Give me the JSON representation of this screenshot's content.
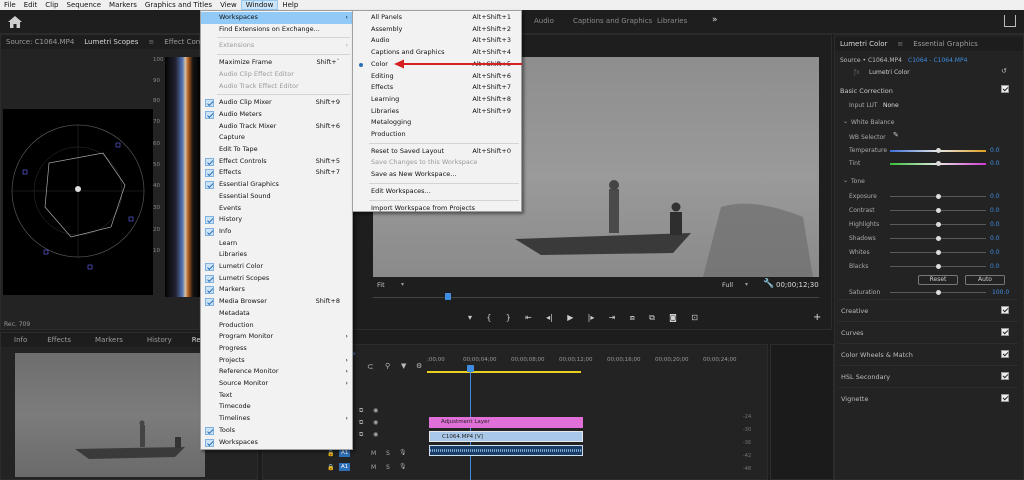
{
  "menubar": {
    "items": [
      "File",
      "Edit",
      "Clip",
      "Sequence",
      "Markers",
      "Graphics and Titles",
      "View",
      "Window",
      "Help"
    ],
    "active": "Window"
  },
  "header": {
    "tabs": [
      "Audio",
      "Captions and Graphics",
      "Libraries"
    ],
    "more": "»"
  },
  "source_panel": {
    "source_label": "Source: C1064.MP4",
    "tab_scopes": "Lumetri Scopes",
    "tab_effects": "Effect Controls",
    "scale": [
      "100",
      "90",
      "80",
      "70",
      "60",
      "50",
      "40",
      "30",
      "20",
      "10"
    ],
    "footer": "Rec. 709"
  },
  "bottom_left": {
    "tabs": [
      "Info",
      "Effects",
      "Markers",
      "History",
      "Reference"
    ]
  },
  "window_menu": {
    "items": [
      {
        "label": "Workspaces",
        "shortcut": "",
        "check": false,
        "submenu": true,
        "disabled": false,
        "highlight": true
      },
      {
        "label": "Find Extensions on Exchange...",
        "shortcut": "",
        "check": false,
        "submenu": false,
        "disabled": false
      },
      {
        "sep": true
      },
      {
        "label": "Extensions",
        "shortcut": "",
        "check": false,
        "submenu": true,
        "disabled": true
      },
      {
        "sep": true
      },
      {
        "label": "Maximize Frame",
        "shortcut": "Shift+`",
        "check": false,
        "submenu": false,
        "disabled": false
      },
      {
        "label": "Audio Clip Effect Editor",
        "shortcut": "",
        "check": false,
        "submenu": false,
        "disabled": true
      },
      {
        "label": "Audio Track Effect Editor",
        "shortcut": "",
        "check": false,
        "submenu": false,
        "disabled": true
      },
      {
        "sep": true
      },
      {
        "label": "Audio Clip Mixer",
        "shortcut": "Shift+9",
        "check": true,
        "submenu": false,
        "disabled": false
      },
      {
        "label": "Audio Meters",
        "shortcut": "",
        "check": true,
        "submenu": false,
        "disabled": false
      },
      {
        "label": "Audio Track Mixer",
        "shortcut": "Shift+6",
        "check": false,
        "submenu": false,
        "disabled": false
      },
      {
        "label": "Capture",
        "shortcut": "",
        "check": false,
        "submenu": false,
        "disabled": false
      },
      {
        "label": "Edit To Tape",
        "shortcut": "",
        "check": false,
        "submenu": false,
        "disabled": false
      },
      {
        "label": "Effect Controls",
        "shortcut": "Shift+5",
        "check": true,
        "submenu": false,
        "disabled": false
      },
      {
        "label": "Effects",
        "shortcut": "Shift+7",
        "check": true,
        "submenu": false,
        "disabled": false
      },
      {
        "label": "Essential Graphics",
        "shortcut": "",
        "check": true,
        "submenu": false,
        "disabled": false
      },
      {
        "label": "Essential Sound",
        "shortcut": "",
        "check": false,
        "submenu": false,
        "disabled": false
      },
      {
        "label": "Events",
        "shortcut": "",
        "check": false,
        "submenu": false,
        "disabled": false
      },
      {
        "label": "History",
        "shortcut": "",
        "check": true,
        "submenu": false,
        "disabled": false
      },
      {
        "label": "Info",
        "shortcut": "",
        "check": true,
        "submenu": false,
        "disabled": false
      },
      {
        "label": "Learn",
        "shortcut": "",
        "check": false,
        "submenu": false,
        "disabled": false
      },
      {
        "label": "Libraries",
        "shortcut": "",
        "check": false,
        "submenu": false,
        "disabled": false
      },
      {
        "label": "Lumetri Color",
        "shortcut": "",
        "check": true,
        "submenu": false,
        "disabled": false
      },
      {
        "label": "Lumetri Scopes",
        "shortcut": "",
        "check": true,
        "submenu": false,
        "disabled": false
      },
      {
        "label": "Markers",
        "shortcut": "",
        "check": true,
        "submenu": false,
        "disabled": false
      },
      {
        "label": "Media Browser",
        "shortcut": "Shift+8",
        "check": true,
        "submenu": false,
        "disabled": false
      },
      {
        "label": "Metadata",
        "shortcut": "",
        "check": false,
        "submenu": false,
        "disabled": false
      },
      {
        "label": "Production",
        "shortcut": "",
        "check": false,
        "submenu": false,
        "disabled": false
      },
      {
        "label": "Program Monitor",
        "shortcut": "",
        "check": false,
        "submenu": true,
        "disabled": false
      },
      {
        "label": "Progress",
        "shortcut": "",
        "check": false,
        "submenu": false,
        "disabled": false
      },
      {
        "label": "Projects",
        "shortcut": "",
        "check": false,
        "submenu": true,
        "disabled": false
      },
      {
        "label": "Reference Monitor",
        "shortcut": "",
        "check": false,
        "submenu": true,
        "disabled": false
      },
      {
        "label": "Source Monitor",
        "shortcut": "",
        "check": false,
        "submenu": true,
        "disabled": false
      },
      {
        "label": "Text",
        "shortcut": "",
        "check": false,
        "submenu": false,
        "disabled": false
      },
      {
        "label": "Timecode",
        "shortcut": "",
        "check": false,
        "submenu": false,
        "disabled": false
      },
      {
        "label": "Timelines",
        "shortcut": "",
        "check": false,
        "submenu": true,
        "disabled": false
      },
      {
        "label": "Tools",
        "shortcut": "",
        "check": true,
        "submenu": false,
        "disabled": false
      },
      {
        "label": "Workspaces",
        "shortcut": "",
        "check": true,
        "submenu": false,
        "disabled": false
      }
    ]
  },
  "workspaces_menu": {
    "items": [
      {
        "label": "All Panels",
        "shortcut": "Alt+Shift+1"
      },
      {
        "label": "Assembly",
        "shortcut": "Alt+Shift+2"
      },
      {
        "label": "Audio",
        "shortcut": "Alt+Shift+3"
      },
      {
        "label": "Captions and Graphics",
        "shortcut": "Alt+Shift+4"
      },
      {
        "label": "Color",
        "shortcut": "Alt+Shift+5",
        "selected": true
      },
      {
        "label": "Editing",
        "shortcut": "Alt+Shift+6"
      },
      {
        "label": "Effects",
        "shortcut": "Alt+Shift+7"
      },
      {
        "label": "Learning",
        "shortcut": "Alt+Shift+8"
      },
      {
        "label": "Libraries",
        "shortcut": "Alt+Shift+9"
      },
      {
        "label": "Metalogging",
        "shortcut": ""
      },
      {
        "label": "Production",
        "shortcut": ""
      },
      {
        "sep": true
      },
      {
        "label": "Reset to Saved Layout",
        "shortcut": "Alt+Shift+0"
      },
      {
        "label": "Save Changes to this Workspace",
        "shortcut": "",
        "disabled": true
      },
      {
        "label": "Save as New Workspace...",
        "shortcut": ""
      },
      {
        "sep": true
      },
      {
        "label": "Edit Workspaces...",
        "shortcut": ""
      },
      {
        "sep": true
      },
      {
        "label": "Import Workspace from Projects",
        "shortcut": ""
      }
    ]
  },
  "program": {
    "fit": "Fit",
    "full": "Full",
    "timecode": "00;00;12;30"
  },
  "timeline": {
    "ruler": [
      ";00;00",
      "00;00;04;00",
      "00;00;08;00",
      "00;00;12;00",
      "00;00;16;00",
      "00;00;20;00",
      "00;00;24;00"
    ],
    "clips": {
      "adjustment": "Adjustment Layer",
      "video": "C1064.MP4 [V]"
    },
    "tracks": [
      "A1",
      "A1"
    ],
    "meter_scale": [
      "-24",
      "-30",
      "-36",
      "-42",
      "-48"
    ]
  },
  "lumetri": {
    "tab_color": "Lumetri Color",
    "tab_graphics": "Essential Graphics",
    "source": "Source • C1064.MP4",
    "sequence": "C1064 - C1064.MP4",
    "effect": "Lumetri Color",
    "basic_correction": "Basic Correction",
    "input_lut_label": "Input LUT",
    "input_lut_value": "None",
    "white_balance": "White Balance",
    "wb_selector": "WB Selector",
    "tone": "Tone",
    "sliders": [
      {
        "label": "Temperature",
        "value": "0.0"
      },
      {
        "label": "Tint",
        "value": "0.0"
      },
      {
        "label": "Exposure",
        "value": "0.0"
      },
      {
        "label": "Contrast",
        "value": "0.0"
      },
      {
        "label": "Highlights",
        "value": "0.0"
      },
      {
        "label": "Shadows",
        "value": "0.0"
      },
      {
        "label": "Whites",
        "value": "0.0"
      },
      {
        "label": "Blacks",
        "value": "0.0"
      }
    ],
    "reset": "Reset",
    "auto": "Auto",
    "saturation_label": "Saturation",
    "saturation_value": "100.0",
    "sections": [
      "Creative",
      "Curves",
      "Color Wheels & Match",
      "HSL Secondary",
      "Vignette"
    ]
  },
  "colors": {
    "menu_bg": "#f2f2f2",
    "menu_highlight": "#91c9f7",
    "accent_blue": "#3f8de0",
    "arrow_red": "#d62020",
    "adjustment_clip": "#e070d8",
    "video_clip": "#a9c7e8"
  }
}
